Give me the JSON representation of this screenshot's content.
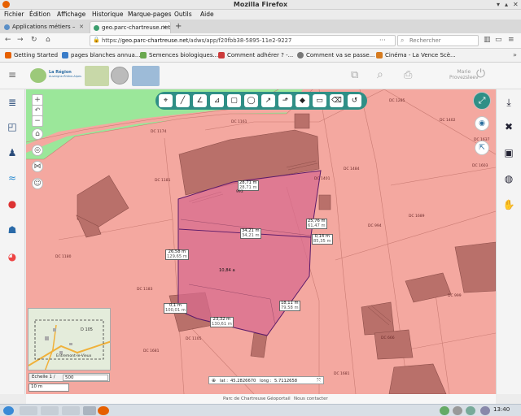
{
  "window": {
    "title": "Mozilla Firefox"
  },
  "menu": [
    "Fichier",
    "Édition",
    "Affichage",
    "Historique",
    "Marque-pages",
    "Outils",
    "Aide"
  ],
  "tabs": [
    {
      "label": "Applications métiers –",
      "active": false
    },
    {
      "label": "geo.parc-chartreuse.net",
      "active": true
    }
  ],
  "url": {
    "prefix": "https://",
    "host": "geo.parc-chartreuse.net",
    "path": "/adws/app/f20fbb38-5895-11e2-9227"
  },
  "search": {
    "placeholder": "Rechercher"
  },
  "bookmarks": [
    "Getting Started",
    "pages blanches annua...",
    "Semences biologiques...",
    "Comment adhérer ? -...",
    "Comment va se passe...",
    "Cinéma - La Vence Scè..."
  ],
  "app": {
    "logo_text_1": "La Région",
    "logo_text_2": "Auvergne-Rhône-Alpes",
    "user": "Marie\nProvezsleev"
  },
  "parcels": [
    "DC 1174",
    "DC 1180",
    "DC 1183",
    "DC 1181",
    "DC 1484",
    "DC 1689",
    "DC 1401",
    "DC 994",
    "DC 1637",
    "DC 999",
    "DC 666",
    "DC 1105",
    "DC 1681",
    "DC 1681",
    "DC 1603",
    "DC 1402",
    "DC 1285",
    "DC 1161",
    "DC 1172",
    "DC 1168"
  ],
  "measures": {
    "top": {
      "a": "28,71 m",
      "b": "28,71 m"
    },
    "mid": {
      "a": "34,21 m",
      "b": "34,21 m"
    },
    "right_top": {
      "a": "25,76 m",
      "b": "61,47 m"
    },
    "right_mid": {
      "a": "0,14 m",
      "b": "85,35 m"
    },
    "left": {
      "a": "26,58 m",
      "b": "129,65 m"
    },
    "area": {
      "a": "10,84 a"
    },
    "left_bottom": {
      "a": "0,1 m",
      "b": "100,01 m"
    },
    "bottom": {
      "a": "23,32 m",
      "b": "130,61 m"
    },
    "right_bottom": {
      "a": "18,11 m",
      "b": "79,58 m"
    },
    "vertex": "993"
  },
  "minimap": {
    "label1": "D 105",
    "label2": "Entremont-le-Vieux"
  },
  "scale": {
    "label": "Echelle 1 /",
    "value": "500",
    "bar": "10 m"
  },
  "coords": {
    "lat_label": "lat :",
    "lat": "45.2826670",
    "lon_label": "long :",
    "lon": "5.7112658"
  },
  "footer": [
    "Parc de Chartreuse",
    "Géoportail",
    "Nous contacter"
  ],
  "tray": {
    "time": "13:40"
  },
  "colors": {
    "teal": "#2f8f86",
    "parcel_bg": "#f4a8a0",
    "selection": "#d86b8e",
    "building": "#b9706a"
  }
}
